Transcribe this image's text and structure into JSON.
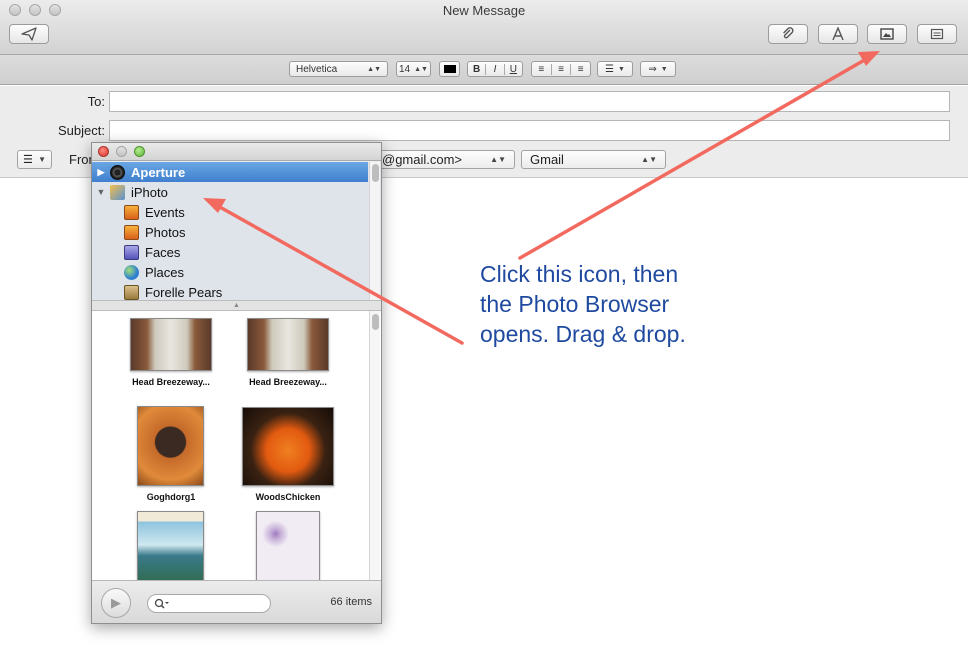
{
  "window": {
    "title": "New Message"
  },
  "format_bar": {
    "font": "Helvetica",
    "size": "14",
    "bold": "B",
    "italic": "I",
    "underline": "U"
  },
  "headers": {
    "to_label": "To:",
    "to_value": "",
    "subject_label": "Subject:",
    "subject_value": "",
    "from_label": "From:",
    "from_value": "@gmail.com>",
    "account": "Gmail"
  },
  "photo_browser": {
    "sources": [
      {
        "label": "Aperture",
        "selected": true,
        "expanded": false
      },
      {
        "label": "iPhoto",
        "selected": false,
        "expanded": true
      }
    ],
    "iphoto_children": [
      "Events",
      "Photos",
      "Faces",
      "Places",
      "Forelle Pears"
    ],
    "photos": [
      {
        "caption": "Head Breezeway..."
      },
      {
        "caption": "Head Breezeway..."
      },
      {
        "caption": "Goghdorg1"
      },
      {
        "caption": "WoodsChicken"
      },
      {
        "caption": ""
      },
      {
        "caption": ""
      }
    ],
    "search_placeholder": "",
    "item_count": "66 items"
  },
  "annotation": {
    "line1": "Click this icon, then",
    "line2": "the Photo Browser",
    "line3": "opens. Drag & drop."
  },
  "colors": {
    "annotation_text": "#1f4aa0",
    "arrow": "#f26a5f",
    "selection": "#3f7fcf"
  },
  "icons": [
    "send-icon",
    "paperclip-icon",
    "font-icon",
    "photo-browser-icon",
    "template-icon",
    "play-icon",
    "search-icon"
  ]
}
